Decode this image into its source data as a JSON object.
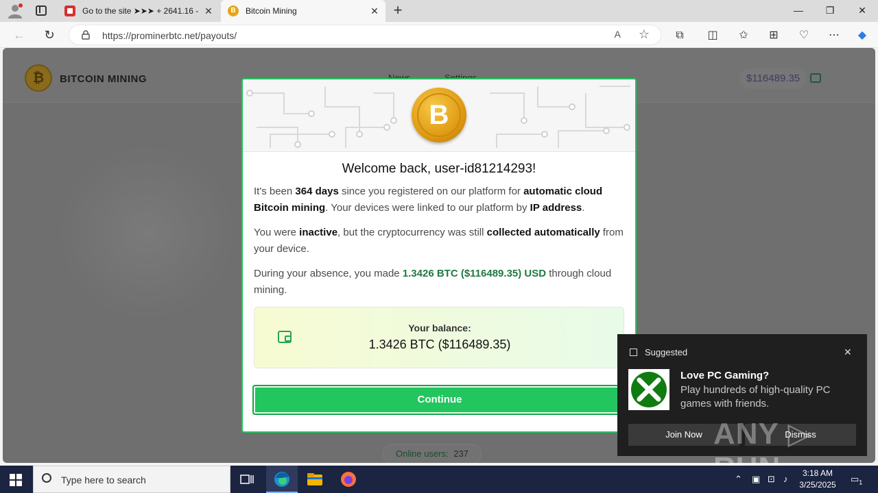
{
  "browser": {
    "tabs": [
      {
        "title": "Go to the site ➤➤➤ + 2641.16 -"
      },
      {
        "title": "Bitcoin Mining"
      }
    ],
    "url": "https://prominerbtc.net/payouts/",
    "read_aloud_glyph": "A",
    "new_tab_glyph": "+",
    "close_glyph": "✕",
    "minimize_glyph": "—",
    "restore_glyph": "❐"
  },
  "site": {
    "logo_text": "BITCOIN MINING",
    "logo_glyph": "₿",
    "nav": [
      "News",
      "Settings"
    ],
    "header_balance": "$116489.35",
    "online_label": "Online users:",
    "online_count": "237"
  },
  "modal": {
    "coin_glyph": "B",
    "title": "Welcome back, user-id81214293!",
    "p1": {
      "t1": "It's been ",
      "b1": "364 days",
      "t2": " since you registered on our platform for ",
      "b2": "automatic cloud Bitcoin mining",
      "t3": ". Your devices were linked to our platform by ",
      "b3": "IP address",
      "t4": "."
    },
    "p2": {
      "t1": "You were ",
      "b1": "inactive",
      "t2": ", but the cryptocurrency was still ",
      "b2": "collected automatically",
      "t3": " from your device."
    },
    "p3": {
      "t1": "During your absence, you made ",
      "g1": "1.3426 BTC ($116489.35) USD",
      "t2": " through cloud mining."
    },
    "balance_label": "Your balance:",
    "balance_value": "1.3426 BTC ($116489.35)",
    "continue_label": "Continue"
  },
  "toast": {
    "header": "Suggested",
    "title": "Love PC Gaming?",
    "body": "Play hundreds of high-quality PC games with friends.",
    "join_label": "Join Now",
    "dismiss_label": "Dismiss",
    "watermark": "ANY ▷ RUN"
  },
  "taskbar": {
    "search_placeholder": "Type here to search",
    "time": "3:18 AM",
    "date": "3/25/2025",
    "notif_count": "1"
  },
  "colors": {
    "accent_green": "#22c55e",
    "btc_gold": "#e6a417",
    "xbox_green": "#107c10"
  }
}
